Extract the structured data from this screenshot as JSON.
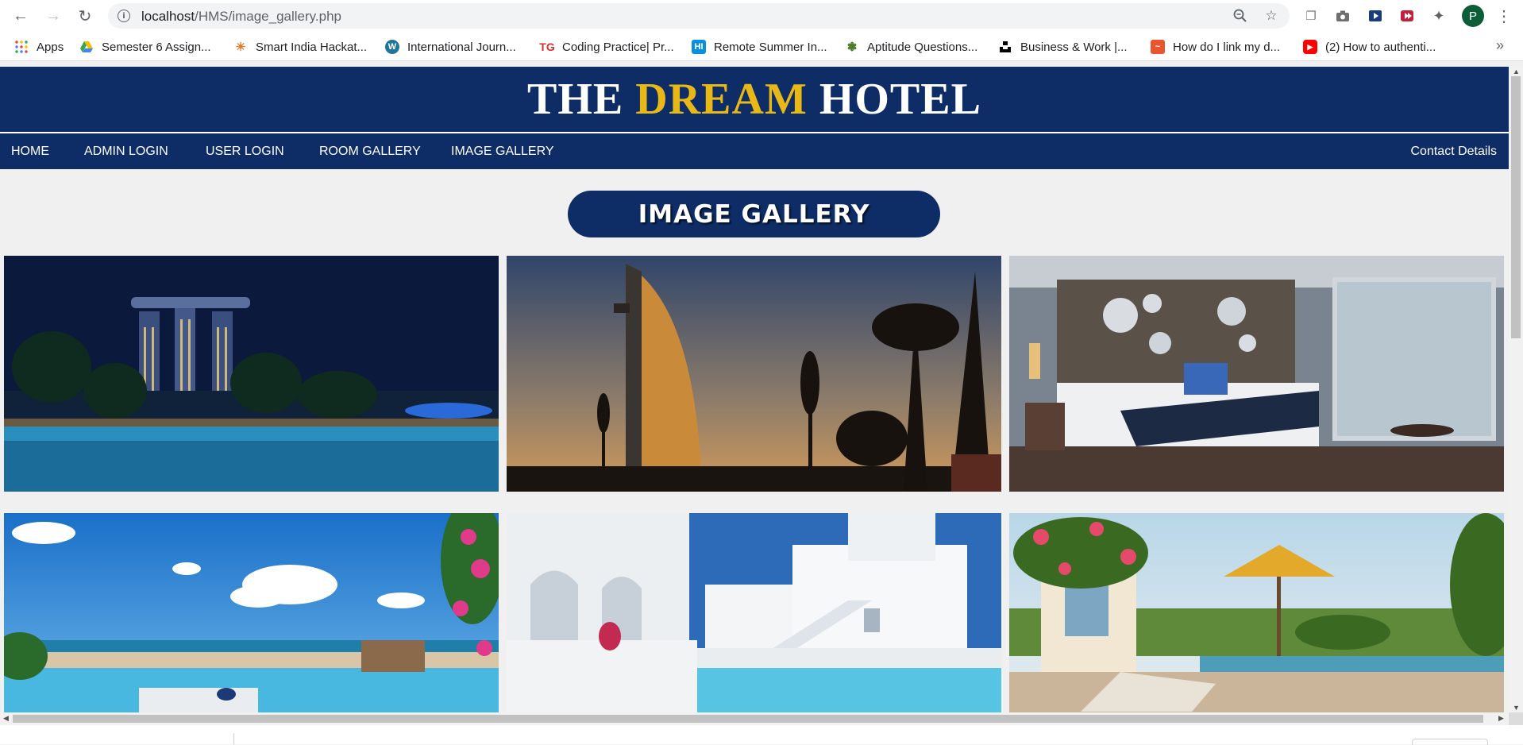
{
  "browser": {
    "url_host": "localhost",
    "url_path": "/HMS/image_gallery.php",
    "profile_initial": "P",
    "bookmarks": [
      {
        "label": "Apps",
        "icon": "apps-grid-icon"
      },
      {
        "label": "Semester 6 Assign...",
        "icon": "google-drive-icon"
      },
      {
        "label": "Smart India Hackat...",
        "icon": "sih-icon"
      },
      {
        "label": "International Journ...",
        "icon": "wordpress-icon"
      },
      {
        "label": "Coding Practice| Pr...",
        "icon": "tg-icon"
      },
      {
        "label": "Remote Summer In...",
        "icon": "hi-icon"
      },
      {
        "label": "Aptitude Questions...",
        "icon": "indiabix-icon"
      },
      {
        "label": "Business & Work |...",
        "icon": "unsplash-icon"
      },
      {
        "label": "How do I link my d...",
        "icon": "zoho-icon"
      },
      {
        "label": "(2) How to authenti...",
        "icon": "youtube-icon"
      }
    ],
    "colors": {
      "accent_profile": "#0b5e37"
    }
  },
  "site": {
    "logo": {
      "word1": "THE ",
      "word2": "DREAM",
      "word3": " HOTEL"
    },
    "nav": {
      "home": "HOME",
      "admin_login": "ADMIN LOGIN",
      "user_login": "USER LOGIN",
      "room_gallery": "ROOM GALLERY",
      "image_gallery": "IMAGE GALLERY",
      "contact": "Contact Details"
    },
    "gallery_title": "IMAGE GALLERY",
    "photos": [
      {
        "name": "marina-bay-night-pool"
      },
      {
        "name": "burj-al-arab-sunset"
      },
      {
        "name": "hotel-bedroom"
      },
      {
        "name": "beach-resort-pool"
      },
      {
        "name": "white-villa-pool"
      },
      {
        "name": "infinity-pool-umbrella"
      }
    ],
    "colors": {
      "navy": "#0e2d66",
      "gold": "#e8b817",
      "background": "#f0f0f0"
    }
  }
}
